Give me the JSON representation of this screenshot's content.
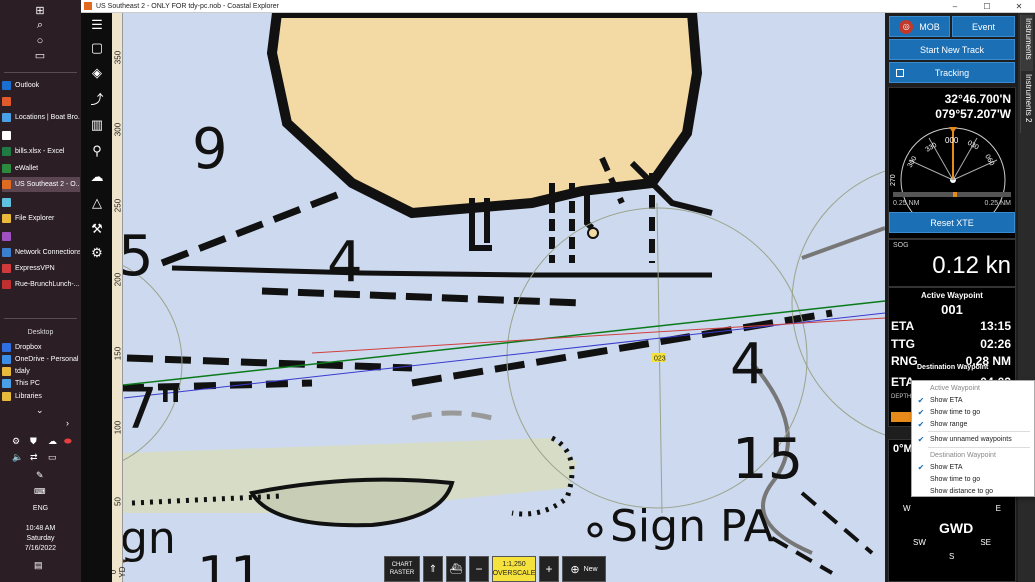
{
  "window": {
    "title": "US Southeast 2 - ONLY FOR tdy-pc.nob - Coastal Explorer",
    "controls": [
      "–",
      "☐",
      "✕"
    ]
  },
  "taskbar": {
    "apps": [
      {
        "label": "Outlook",
        "color": "#1a6fd0"
      },
      {
        "label": "",
        "color": "#e05a2b"
      },
      {
        "label": "Locations | Boat Bro...",
        "color": "#4aa0e6"
      },
      {
        "label": "",
        "color": "#ffffff"
      },
      {
        "label": "bills.xlsx - Excel",
        "color": "#1f7a44"
      },
      {
        "label": "eWallet",
        "color": "#2b8a3e"
      },
      {
        "label": "US Southeast 2 - O...",
        "color": "#e06a1f"
      },
      {
        "label": "",
        "color": "#60c0e0"
      },
      {
        "label": "File Explorer",
        "color": "#e8b93a"
      },
      {
        "label": "",
        "color": "#a050c0"
      },
      {
        "label": "Network Connections",
        "color": "#3a7fd0"
      },
      {
        "label": "ExpressVPN",
        "color": "#d03a3a"
      },
      {
        "label": "Rue-BrunchLunch-...",
        "color": "#c03030"
      }
    ],
    "desktop_label": "Desktop",
    "desktop_items": [
      {
        "label": "Dropbox",
        "color": "#2f6fe0"
      },
      {
        "label": "OneDrive - Personal",
        "color": "#3a8ee6"
      },
      {
        "label": "tdaly",
        "color": "#e8b93a"
      },
      {
        "label": "This PC",
        "color": "#4aa0e6"
      },
      {
        "label": "Libraries",
        "color": "#e8b93a"
      }
    ],
    "language": "ENG",
    "time": "10:48 AM",
    "day": "Saturday",
    "date": "7/16/2022"
  },
  "chart": {
    "ruler_labels": [
      "350",
      "300",
      "250",
      "200",
      "150",
      "100",
      "50",
      "0 YD"
    ],
    "depths": [
      "9",
      "4",
      "5",
      "4",
      "7\"",
      "15",
      "11"
    ],
    "sign_text": "Sign PA",
    "sign_text2": "gn",
    "waypoint_label": "023",
    "bottom": {
      "chart_label": "CHART",
      "raster_label": "RASTER",
      "scale": "1:1,250",
      "overscale": "OVERSCALE",
      "minus": "−",
      "plus": "+",
      "new_label": "New"
    }
  },
  "panel": {
    "mob_label": "MOB",
    "event_label": "Event",
    "start_track_label": "Start New Track",
    "tracking_label": "Tracking",
    "lat": "32°46.700'N",
    "lon": "079°57.207'W",
    "compass_ticks": [
      "300",
      "330",
      "000",
      "030",
      "060",
      "270"
    ],
    "xte_left": "0.25 NM",
    "xte_right": "0.25 NM",
    "reset_xte_label": "Reset XTE",
    "sog_label": "SOG",
    "sog_value": "0.12 kn",
    "active_wp_label": "Active Waypoint",
    "active_wp_value": "001",
    "eta_label": "ETA",
    "eta_value": "13:15",
    "ttg_label": "TTG",
    "ttg_value": "02:26",
    "rng_label": "RNG",
    "rng_value": "0.28 NM",
    "dest_wp_label": "Destination Waypoint",
    "eta2_label": "ETA",
    "eta2_value": "04:03",
    "depth_label": "DEPTH",
    "cog_value": "0°M",
    "gwd_label": "GWD",
    "compass_w": "W",
    "compass_e": "E",
    "compass_sw": "SW",
    "compass_se": "SE",
    "compass_s": "S"
  },
  "sidetabs": [
    "Instruments",
    "Instruments 2"
  ],
  "context_menu": {
    "active_header": "Active Waypoint",
    "show_eta": "Show ETA",
    "show_time": "Show time to go",
    "show_range": "Show range",
    "show_unnamed": "Show unnamed waypoints",
    "dest_header": "Destination Waypoint",
    "show_eta2": "Show ETA",
    "show_time2": "Show time to go",
    "show_distance": "Show distance to go"
  },
  "colors": {
    "accent": "#1a6fb5",
    "water": "#cdd9ee",
    "land": "#f3d9a4",
    "shoal": "#d6dcc6",
    "route_green": "#0a7a1a",
    "route_blue": "#3a3ad0",
    "route_red": "#d04040"
  }
}
